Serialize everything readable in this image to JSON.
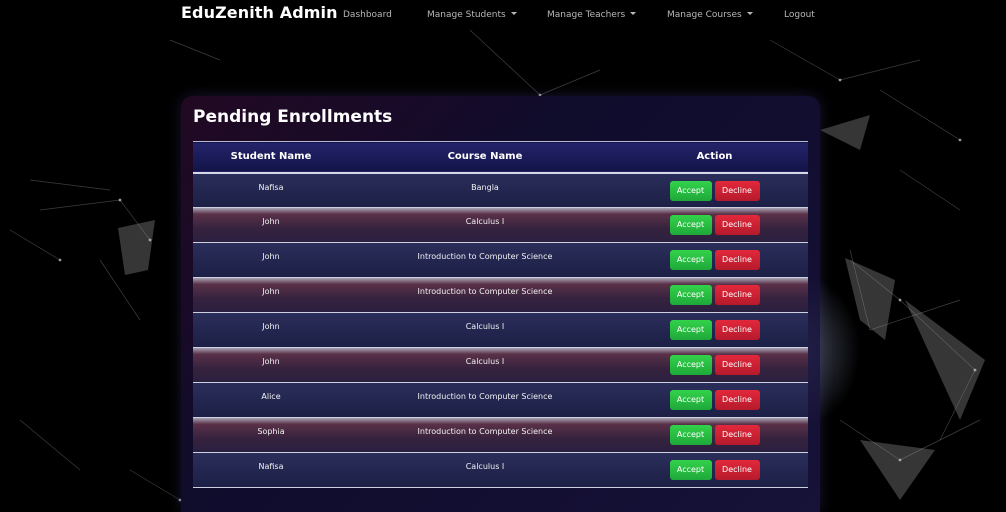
{
  "navbar": {
    "brand": "EduZenith Admin",
    "items": [
      {
        "label": "Dashboard",
        "dropdown": false
      },
      {
        "label": "Manage Students",
        "dropdown": true
      },
      {
        "label": "Manage Teachers",
        "dropdown": true
      },
      {
        "label": "Manage Courses",
        "dropdown": true
      },
      {
        "label": "Logout",
        "dropdown": false
      }
    ]
  },
  "main": {
    "title": "Pending Enrollments",
    "table": {
      "headers": [
        "Student Name",
        "Course Name",
        "Action"
      ],
      "rows": [
        {
          "student": "Nafisa",
          "course": "Bangla"
        },
        {
          "student": "John",
          "course": "Calculus I"
        },
        {
          "student": "John",
          "course": "Introduction to Computer Science"
        },
        {
          "student": "John",
          "course": "Introduction to Computer Science"
        },
        {
          "student": "John",
          "course": "Calculus I"
        },
        {
          "student": "John",
          "course": "Calculus I"
        },
        {
          "student": "Alice",
          "course": "Introduction to Computer Science"
        },
        {
          "student": "Sophia",
          "course": "Introduction to Computer Science"
        },
        {
          "student": "Nafisa",
          "course": "Calculus I"
        }
      ],
      "accept_label": "Accept",
      "decline_label": "Decline"
    }
  },
  "colors": {
    "background": "#000000",
    "accept": "#22b43a",
    "decline": "#d4203a",
    "header_bg": "#1a1a55"
  }
}
